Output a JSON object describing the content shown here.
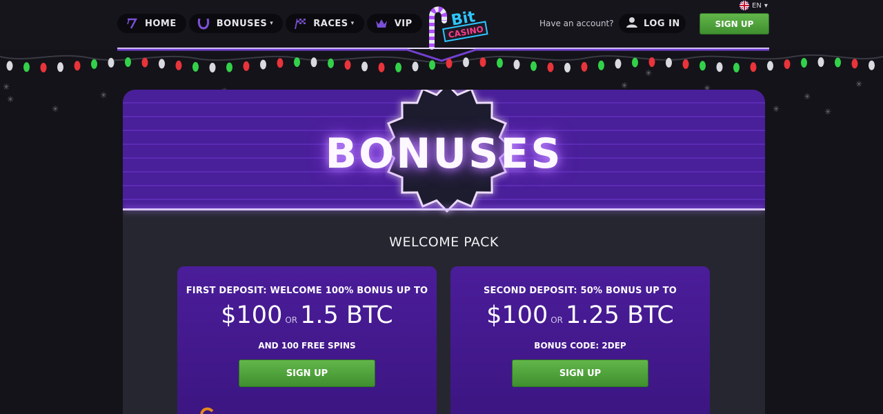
{
  "nav": {
    "items": [
      {
        "label": "HOME",
        "icon": "slot-seven-icon",
        "has_dropdown": false
      },
      {
        "label": "BONUSES",
        "icon": "horseshoe-icon",
        "has_dropdown": true
      },
      {
        "label": "RACES",
        "icon": "checkered-flag-icon",
        "has_dropdown": true
      },
      {
        "label": "VIP",
        "icon": "crown-icon",
        "has_dropdown": false
      }
    ]
  },
  "brand": {
    "logo_text_top": "Bit",
    "logo_text_bottom": "CASINO"
  },
  "header": {
    "language": "EN",
    "have_account": "Have an account?",
    "login_label": "LOG IN",
    "signup_label": "SIGN UP"
  },
  "banner": {
    "title": "BONUSES"
  },
  "welcome": {
    "title": "WELCOME PACK",
    "cards": [
      {
        "head": "FIRST DEPOSIT: WELCOME 100% BONUS UP TO",
        "amount_fiat": "$100",
        "or": "OR",
        "amount_crypto": "1.5 BTC",
        "sub": "AND 100 FREE SPINS",
        "button": "SIGN UP"
      },
      {
        "head": "SECOND DEPOSIT: 50% BONUS UP TO",
        "amount_fiat": "$100",
        "or": "OR",
        "amount_crypto": "1.25 BTC",
        "sub": "BONUS CODE: 2DEP",
        "button": "SIGN UP"
      }
    ]
  },
  "colors": {
    "accent_purple": "#5b2cb4",
    "signup_green": "#4fa43b",
    "background": "#141319"
  }
}
